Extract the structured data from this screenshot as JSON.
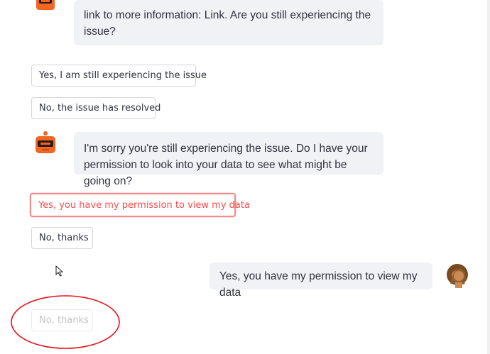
{
  "messages": [
    {
      "role": "assistant",
      "text_lines": [
        "link to more information: Link. Are you still experiencing the",
        "issue?"
      ]
    },
    {
      "role": "assistant",
      "text_lines": [
        "I'm sorry you're still experiencing the issue. Do I have your",
        "permission to look into your data to see what might be going on?"
      ]
    },
    {
      "role": "user",
      "text": "Yes, you have my permission to view my data"
    }
  ],
  "options_1": {
    "yes": "Yes, I am still experiencing the issue",
    "no": "No, the issue has resolved"
  },
  "options_2": {
    "yes": "Yes, you have my permission to view my data",
    "no": "No, thanks"
  },
  "disabled_option": "No, thanks",
  "colors": {
    "accent_red": "#ff4b4b",
    "annotation_circle": "#e3111b",
    "bubble_bg": "#f0f2f6",
    "bot_orange": "#f26522"
  },
  "icons": [
    "bot-avatar-icon",
    "user-avatar-icon",
    "mouse-cursor-icon"
  ]
}
